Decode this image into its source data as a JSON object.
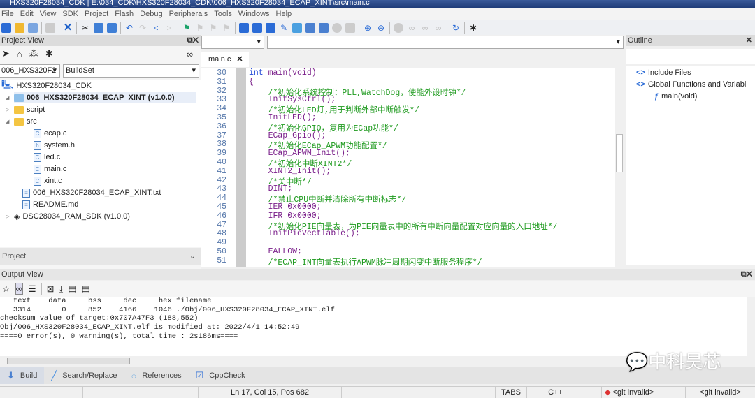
{
  "window_title": "HXS320F28034_CDK | E:\\034_CDK\\HXS320F28034_CDK\\006_HXS320F28034_ECAP_XINT\\src\\main.c",
  "menu": [
    "File",
    "Edit",
    "View",
    "SDK",
    "Project",
    "Flash",
    "Debug",
    "Peripherals",
    "Tools",
    "Windows",
    "Help"
  ],
  "project_view": {
    "title": "Project View",
    "project_select": "006_HXS320F2",
    "buildset_select": "BuildSet",
    "footer_label": "Project",
    "tree": [
      {
        "label": "HXS320F28034_CDK",
        "icon": "computer-icon",
        "level": 0
      },
      {
        "label": "006_HXS320F28034_ECAP_XINT (v1.0.0)",
        "icon": "folder-icon",
        "level": 1,
        "bold": true,
        "expanded": true
      },
      {
        "label": "script",
        "icon": "folder-icon",
        "level": 2,
        "expanded": false
      },
      {
        "label": "src",
        "icon": "folder-icon",
        "level": 2,
        "expanded": true
      },
      {
        "label": "ecap.c",
        "icon": "c-file-icon",
        "level": 3
      },
      {
        "label": "system.h",
        "icon": "h-file-icon",
        "level": 3
      },
      {
        "label": "led.c",
        "icon": "c-file-icon",
        "level": 3
      },
      {
        "label": "main.c",
        "icon": "c-file-icon",
        "level": 3
      },
      {
        "label": "xint.c",
        "icon": "c-file-icon",
        "level": 3
      },
      {
        "label": "006_HXS320F28034_ECAP_XINT.txt",
        "icon": "text-file-icon",
        "level": 2
      },
      {
        "label": "README.md",
        "icon": "text-file-icon",
        "level": 2
      },
      {
        "label": "DSC28034_RAM_SDK (v1.0.0)",
        "icon": "package-icon",
        "level": 1,
        "expanded": false
      }
    ]
  },
  "editor": {
    "tab": "main.c",
    "lines": [
      {
        "n": "30",
        "code": "int main(void)",
        "type": "decl"
      },
      {
        "n": "31",
        "code": "{",
        "type": "code"
      },
      {
        "n": "32",
        "code": "    /*初始化系统控制：PLL,WatchDog，使能外设时钟*/",
        "type": "comment"
      },
      {
        "n": "33",
        "code": "    InitSysCtrl();",
        "type": "code"
      },
      {
        "n": "34",
        "code": "    /*初始化LED灯,用于判断外部中断触发*/",
        "type": "comment"
      },
      {
        "n": "35",
        "code": "    InitLED();",
        "type": "code"
      },
      {
        "n": "36",
        "code": "    /*初始化GPIO，复用为ECap功能*/",
        "type": "comment"
      },
      {
        "n": "37",
        "code": "    ECap_Gpio();",
        "type": "code"
      },
      {
        "n": "38",
        "code": "    /*初始化ECap_APWM功能配置*/",
        "type": "comment"
      },
      {
        "n": "39",
        "code": "    ECap_APWM_Init();",
        "type": "code"
      },
      {
        "n": "40",
        "code": "    /*初始化中断XINT2*/",
        "type": "comment"
      },
      {
        "n": "41",
        "code": "    XINT2_Init();",
        "type": "code"
      },
      {
        "n": "42",
        "code": "    /*关中断*/",
        "type": "comment"
      },
      {
        "n": "43",
        "code": "    DINT;",
        "type": "code"
      },
      {
        "n": "44",
        "code": "    /*禁止CPU中断并清除所有中断标志*/",
        "type": "comment"
      },
      {
        "n": "45",
        "code": "    IER=0x0000;",
        "type": "code"
      },
      {
        "n": "46",
        "code": "    IFR=0x0000;",
        "type": "code"
      },
      {
        "n": "47",
        "code": "    /*初始化PIE向量表，为PIE向量表中的所有中断向量配置对应向量的入口地址*/",
        "type": "comment"
      },
      {
        "n": "48",
        "code": "    InitPieVectTable();",
        "type": "code"
      },
      {
        "n": "49",
        "code": "",
        "type": "code"
      },
      {
        "n": "50",
        "code": "    EALLOW;",
        "type": "code"
      },
      {
        "n": "51",
        "code": "    /*ECAP_INT向量表执行APWM脉冲周期闪变中断服务程序*/",
        "type": "comment"
      }
    ]
  },
  "outline": {
    "title": "Outline",
    "items": [
      {
        "label": "Include Files",
        "level": 0
      },
      {
        "label": "Global Functions and Variabl",
        "level": 0
      },
      {
        "label": "main(void)",
        "level": 1
      }
    ]
  },
  "output": {
    "title": "Output View",
    "lines": [
      "   text    data     bss     dec     hex filename",
      "   3314       0     852    4166    1046 ./Obj/006_HXS320F28034_ECAP_XINT.elf",
      "checksum value of target:0x707A47F3 (188,552)",
      "Obj/006_HXS320F28034_ECAP_XINT.elf is modified at: 2022/4/1 14:52:49",
      "====0 error(s), 0 warning(s), total time : 2s186ms===="
    ]
  },
  "bottom_tabs": [
    "Build",
    "Search/Replace",
    "References",
    "CppCheck"
  ],
  "status": {
    "position": "Ln 17, Col 15, Pos 682",
    "indent": "TABS",
    "language": "C++",
    "git1": "<git invalid>",
    "git2": "<git invalid>"
  },
  "watermark": "中科昊芯"
}
